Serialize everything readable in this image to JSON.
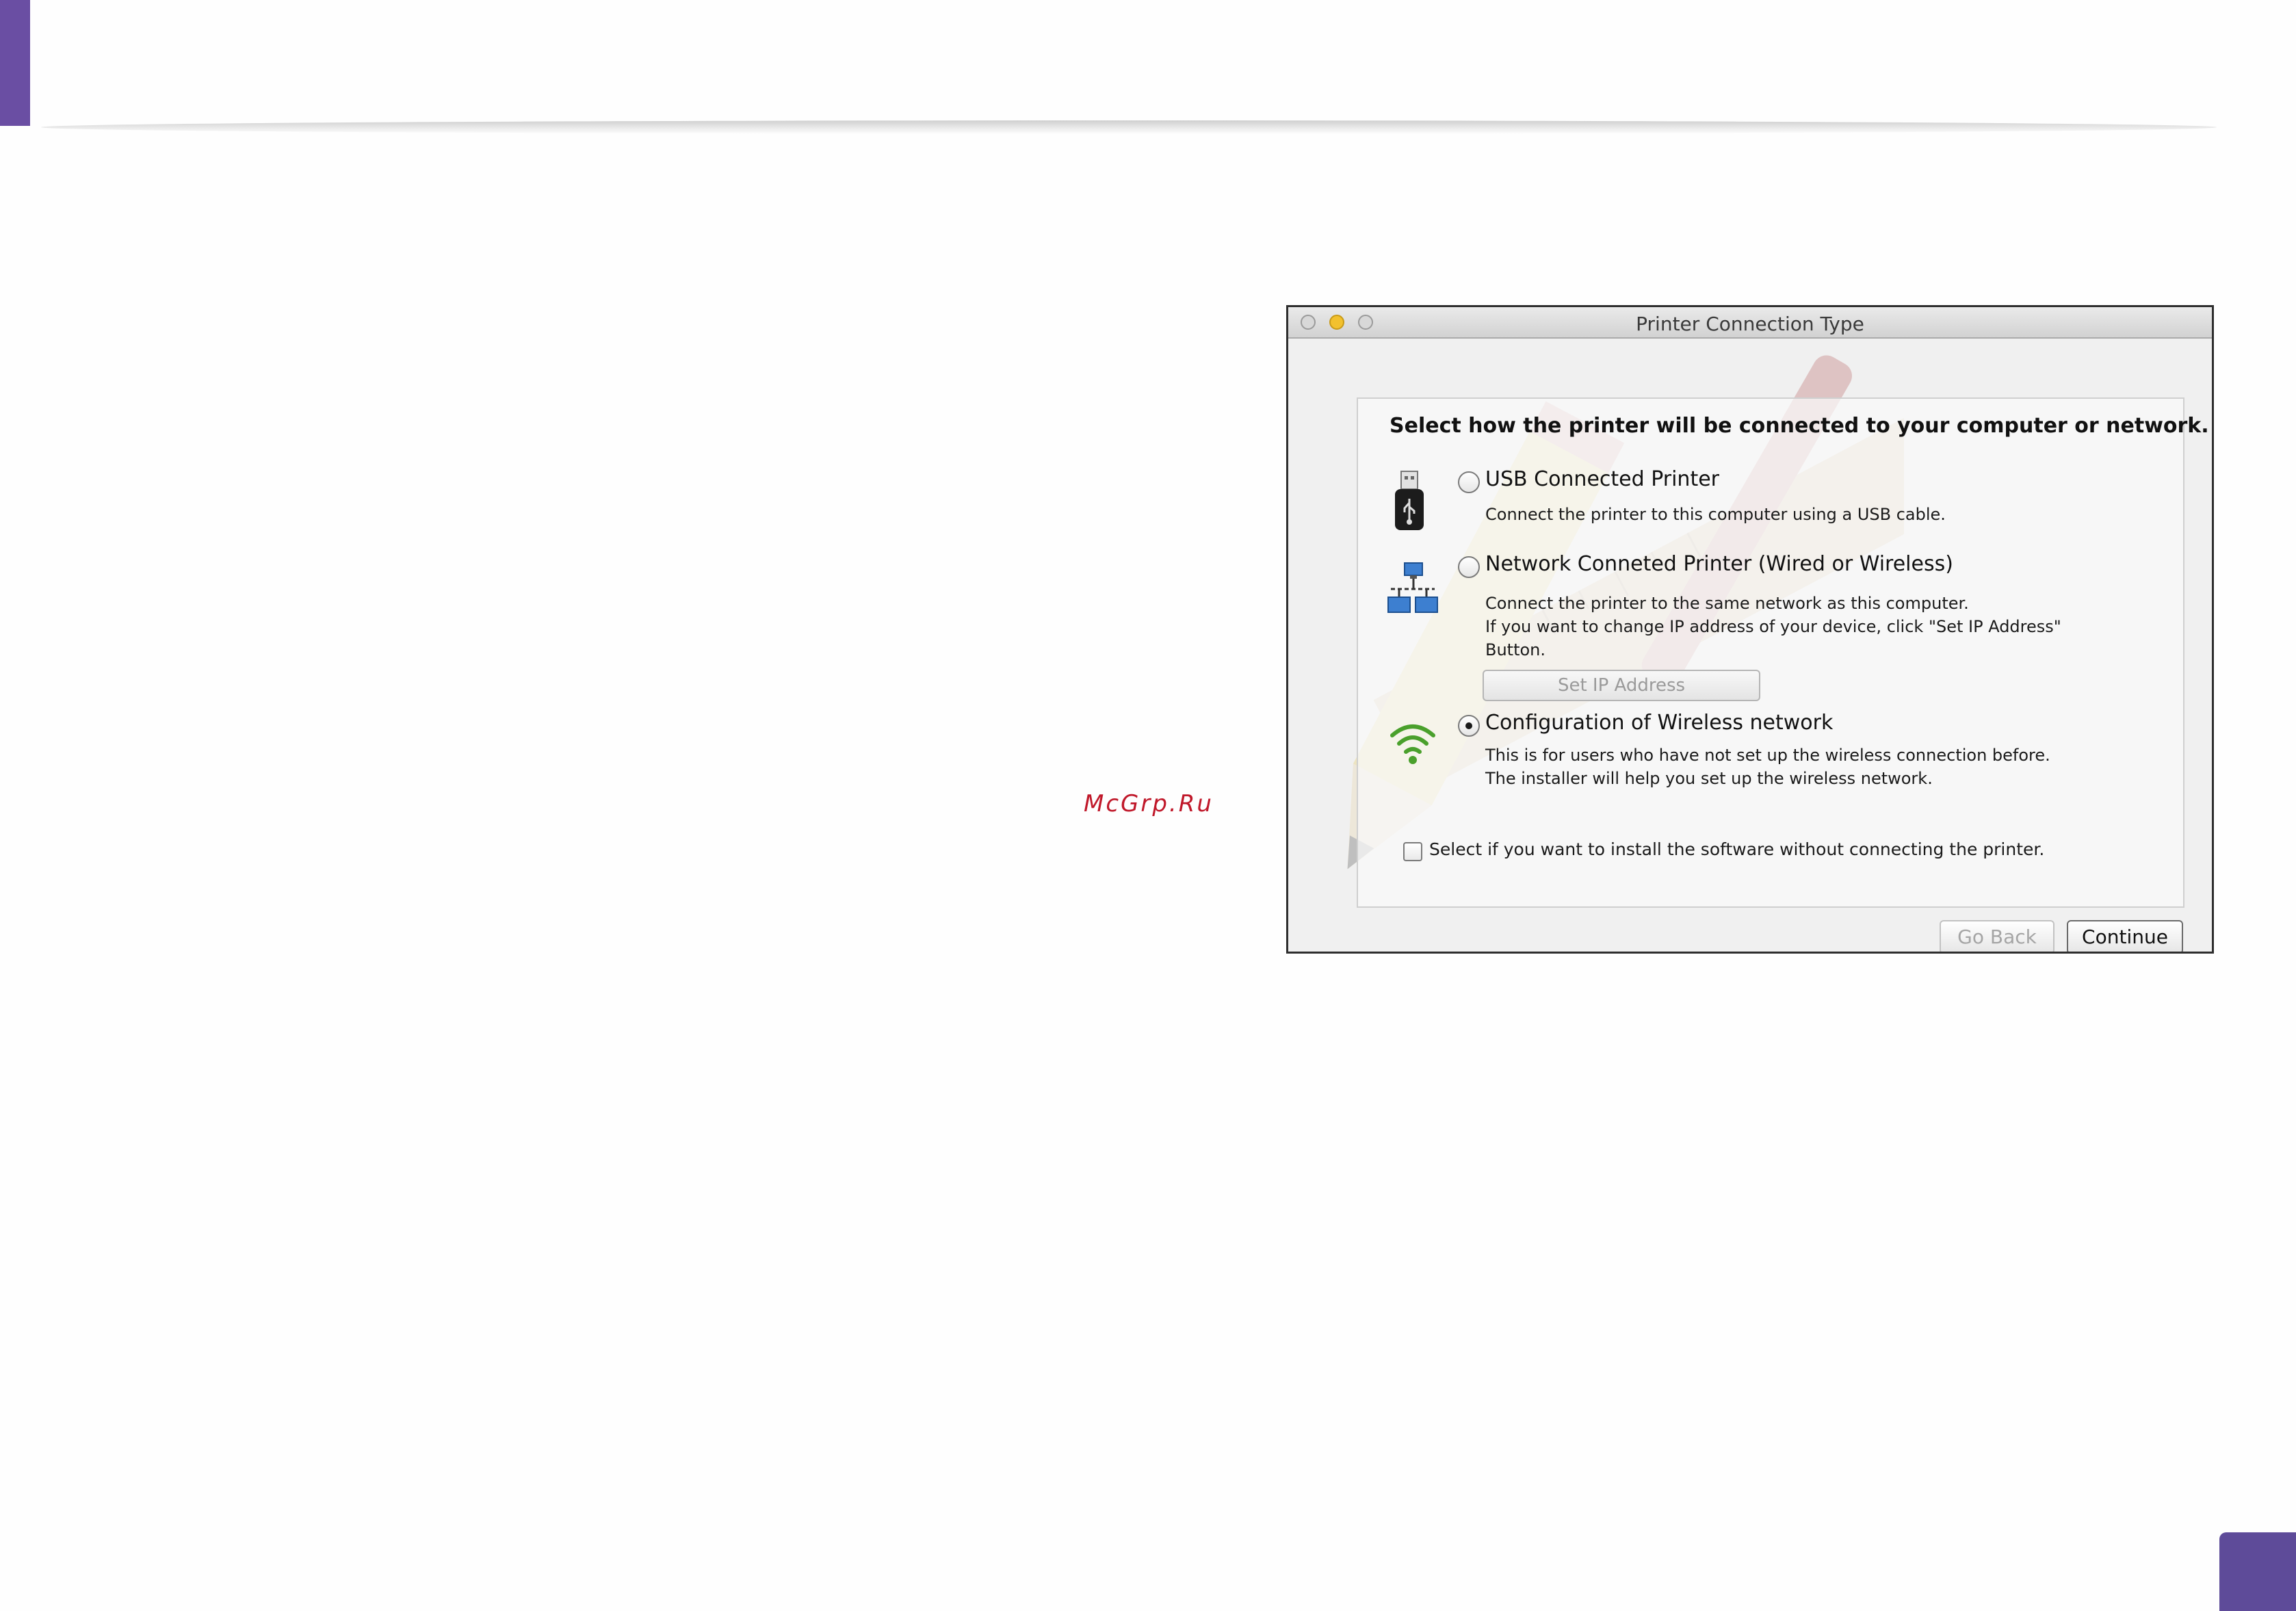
{
  "watermark": "McGrp.Ru",
  "dialog": {
    "title": "Printer Connection Type",
    "heading": "Select how the printer will be connected to your computer or network.",
    "options": [
      {
        "label": "USB Connected Printer",
        "description": [
          "Connect the printer to this computer using a USB cable."
        ],
        "icon": "usb-drive-icon",
        "selected": false
      },
      {
        "label": "Network Conneted Printer (Wired or Wireless)",
        "description": [
          "Connect the printer to the same network as this computer.",
          "If you want to change IP address of your device, click \"Set IP Address\"",
          "Button."
        ],
        "icon": "network-computers-icon",
        "selected": false
      },
      {
        "label": "Configuration of Wireless network",
        "description": [
          "This is for users who have not set up the wireless connection before.",
          "The installer will help you set up the wireless network."
        ],
        "icon": "wifi-icon",
        "selected": true
      }
    ],
    "set_ip_button": "Set IP Address",
    "install_without_printer": {
      "label": "Select if you want to install the software without connecting the printer.",
      "checked": false
    },
    "buttons": {
      "back": "Go Back",
      "continue": "Continue"
    }
  },
  "colors": {
    "brand_purple": "#6a4ea3",
    "watermark_red": "#c0182a",
    "wifi_green": "#4aa02c"
  }
}
